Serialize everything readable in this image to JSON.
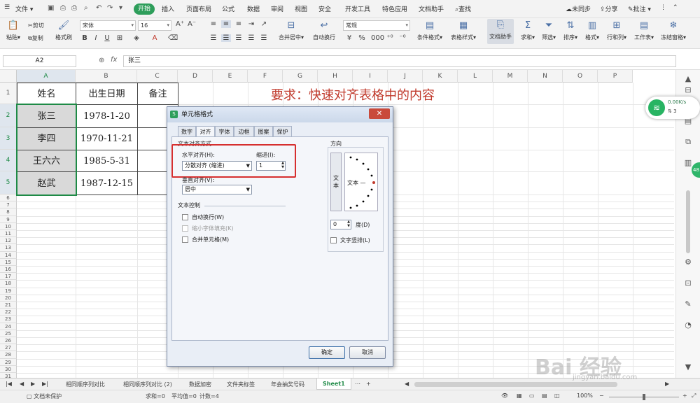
{
  "menu": {
    "file": "文件",
    "tabs": [
      "开始",
      "插入",
      "页面布局",
      "公式",
      "数据",
      "审阅",
      "视图",
      "安全",
      "开发工具",
      "特色应用",
      "文档助手"
    ],
    "search": "查找",
    "sync": "未同步",
    "share": "分享",
    "comment": "批注"
  },
  "ribbon": {
    "paste": "粘贴",
    "cut": "剪切",
    "copy": "复制",
    "format_painter": "格式刷",
    "font_name": "宋体",
    "font_size": "16",
    "merge_center": "合并居中",
    "wrap": "自动换行",
    "number_format": "常规",
    "cond_format": "条件格式",
    "table_style": "表格样式",
    "doc_assistant": "文档助手",
    "sum": "求和",
    "filter": "筛选",
    "sort": "排序",
    "format": "格式",
    "rowcol": "行和列",
    "worksheet": "工作表",
    "freeze": "冻结窗格"
  },
  "formula_bar": {
    "name_box": "A2",
    "fx": "fx",
    "value": "张三"
  },
  "columns": [
    "A",
    "B",
    "C",
    "D",
    "E",
    "F",
    "G",
    "H",
    "I",
    "J",
    "K",
    "L",
    "M",
    "N",
    "O",
    "P"
  ],
  "rows": [
    "1",
    "2",
    "3",
    "4",
    "5",
    "6",
    "7",
    "8",
    "9",
    "10",
    "11",
    "12",
    "13",
    "14",
    "15",
    "16",
    "17",
    "18",
    "19",
    "20",
    "21",
    "22",
    "23",
    "24",
    "25",
    "26",
    "27",
    "28",
    "29",
    "30",
    "31",
    "32",
    "33"
  ],
  "table": {
    "headers": [
      "姓名",
      "出生日期",
      "备注"
    ],
    "data": [
      [
        "张三",
        "1978-1-20"
      ],
      [
        "李四",
        "1970-11-21"
      ],
      [
        "王六六",
        "1985-5-31"
      ],
      [
        "赵武",
        "1987-12-15"
      ]
    ]
  },
  "requirement": "要求：快速对齐表格中的内容",
  "net_widget": {
    "speed": "0.00K/s",
    "count": "3",
    "badge": "48"
  },
  "sheet_tabs": [
    "相同顺序列对比",
    "相同顺序列对比 (2)",
    "数据加密",
    "文件夹标签",
    "年会抽奖号码",
    "Sheet1"
  ],
  "status": {
    "protect": "文档未保护",
    "sum": "求和=0",
    "avg": "平均值=0",
    "count": "计数=4",
    "zoom": "100%"
  },
  "dialog": {
    "title": "单元格格式",
    "tabs": [
      "数字",
      "对齐",
      "字体",
      "边框",
      "图案",
      "保护"
    ],
    "section_align": "文本对齐方式",
    "h_align_label": "水平对齐(H):",
    "h_align_value": "分散对齐 (缩进)",
    "indent_label": "缩进(I):",
    "indent_value": "1",
    "v_align_label": "垂直对齐(V):",
    "v_align_value": "居中",
    "section_control": "文本控制",
    "wrap": "自动换行(W)",
    "shrink": "缩小字体填充(K)",
    "merge": "合并单元格(M)",
    "orientation": "方向",
    "text_vertical": "文本",
    "text_horizontal": "文本 —",
    "degree_value": "0",
    "degree_label": "度(D)",
    "vertical_text": "文字竖排(L)",
    "ok": "确定",
    "cancel": "取消"
  },
  "watermark": {
    "brand": "Bai 经验",
    "url": "jingyan.baidu.com"
  },
  "colors": {
    "accent": "#2e9e5b",
    "req_text": "#c0392b",
    "highlight_box": "#d62f2f"
  }
}
